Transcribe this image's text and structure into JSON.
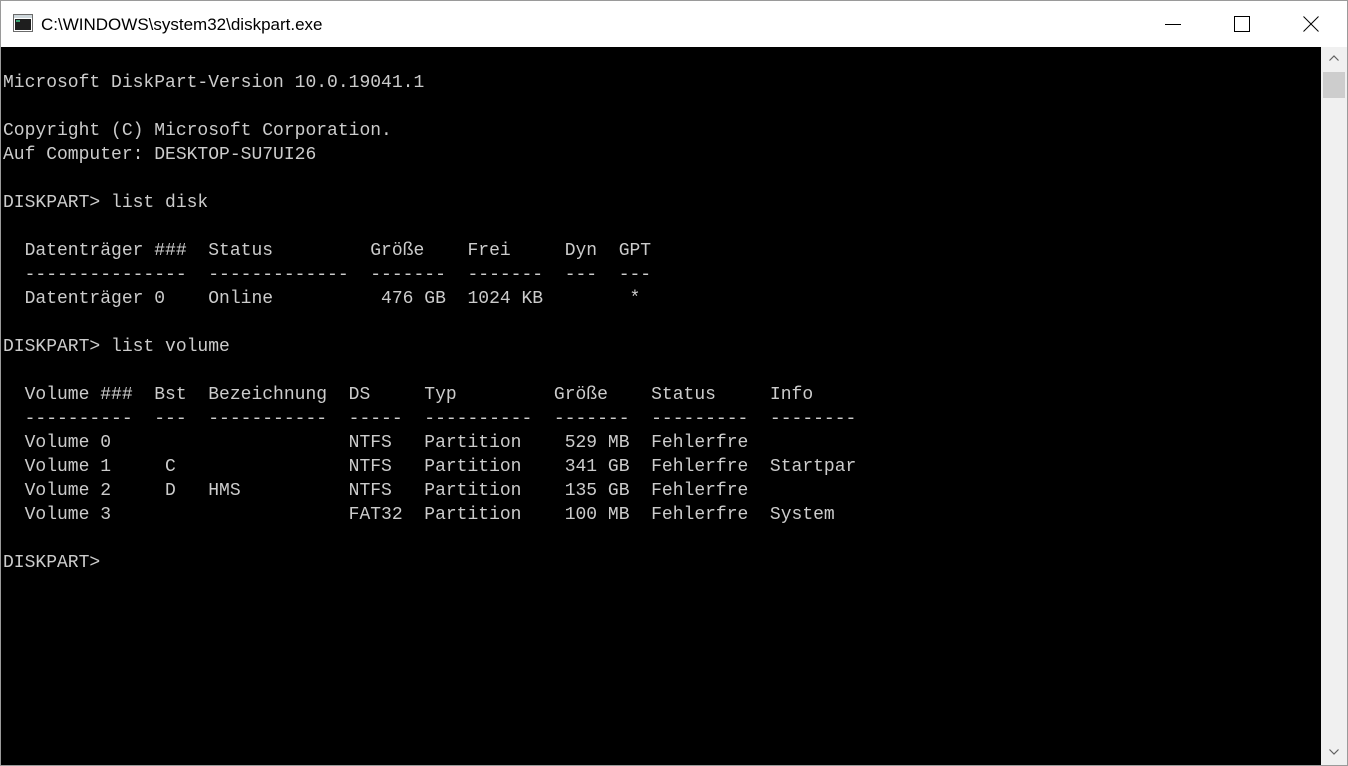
{
  "window": {
    "title": "C:\\WINDOWS\\system32\\diskpart.exe"
  },
  "titlebar": {
    "minimize_icon": "minimize-icon",
    "maximize_icon": "maximize-icon",
    "close_icon": "close-icon"
  },
  "console": {
    "lines": [
      "Microsoft DiskPart-Version 10.0.19041.1",
      "",
      "Copyright (C) Microsoft Corporation.",
      "Auf Computer: DESKTOP-SU7UI26",
      "",
      "DISKPART> list disk",
      "",
      "  Datenträger ###  Status         Größe    Frei     Dyn  GPT",
      "  ---------------  -------------  -------  -------  ---  ---",
      "  Datenträger 0    Online          476 GB  1024 KB        *",
      "",
      "DISKPART> list volume",
      "",
      "  Volume ###  Bst  Bezeichnung  DS     Typ         Größe    Status     Info",
      "  ----------  ---  -----------  -----  ----------  -------  ---------  --------",
      "  Volume 0                      NTFS   Partition    529 MB  Fehlerfre",
      "  Volume 1     C                NTFS   Partition    341 GB  Fehlerfre  Startpar",
      "  Volume 2     D   HMS          NTFS   Partition    135 GB  Fehlerfre",
      "  Volume 3                      FAT32  Partition    100 MB  Fehlerfre  System",
      "",
      "DISKPART> "
    ]
  },
  "colors": {
    "console_background": "#000000",
    "console_text": "#cccccc",
    "titlebar_background": "#ffffff",
    "scrollbar_track": "#f0f0f0",
    "scrollbar_thumb": "#cdcdcd"
  }
}
